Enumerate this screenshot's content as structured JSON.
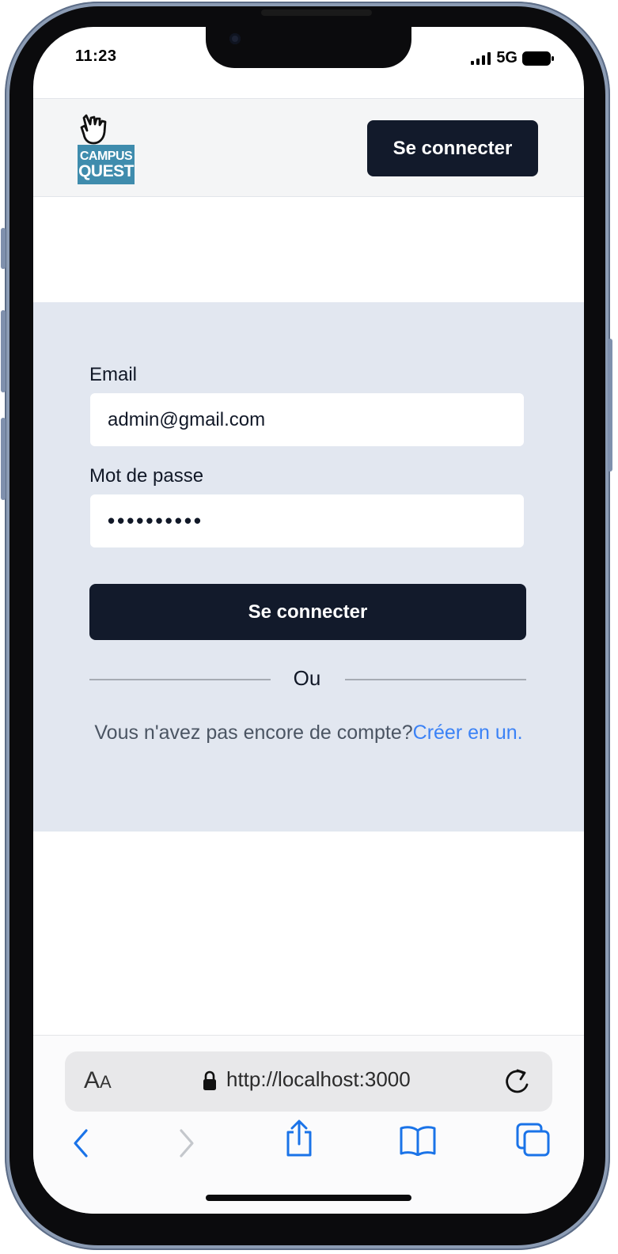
{
  "status_bar": {
    "time": "11:23",
    "network": "5G"
  },
  "header": {
    "logo_line1": "CAMPUS",
    "logo_line2": "QUEST",
    "login_button": "Se connecter"
  },
  "login_form": {
    "email_label": "Email",
    "email_value": "admin@gmail.com",
    "password_label": "Mot de passe",
    "password_value": "••••••••••",
    "submit_button": "Se connecter",
    "divider_text": "Ou",
    "signup_prompt": "Vous n'avez pas encore de compte?",
    "signup_link": "Créer en un."
  },
  "browser": {
    "text_size_label_big": "A",
    "text_size_label_small": "A",
    "url": "http://localhost:3000"
  },
  "colors": {
    "primary_button": "#121a2b",
    "panel_background": "#e2e7f0",
    "link": "#3b82f6",
    "ios_blue": "#1a73e8"
  }
}
